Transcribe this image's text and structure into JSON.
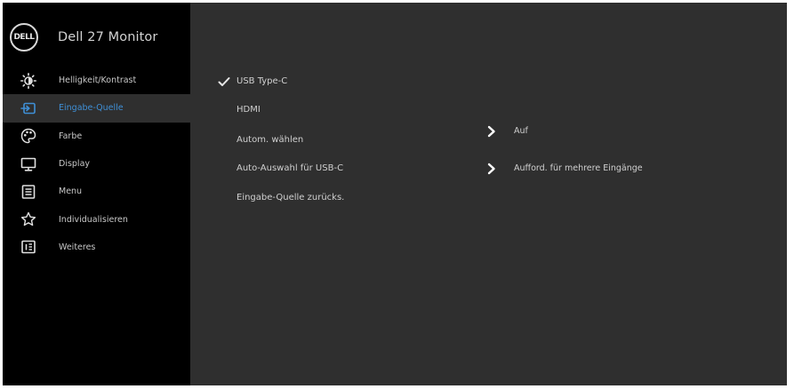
{
  "header": {
    "logo_text": "DELL",
    "title": "Dell 27 Monitor"
  },
  "sidebar": {
    "items": [
      {
        "label": "Helligkeit/Kontrast",
        "icon": "brightness-icon",
        "active": false
      },
      {
        "label": "Eingabe-Quelle",
        "icon": "input-source-icon",
        "active": true
      },
      {
        "label": "Farbe",
        "icon": "color-palette-icon",
        "active": false
      },
      {
        "label": "Display",
        "icon": "display-icon",
        "active": false
      },
      {
        "label": "Menu",
        "icon": "menu-icon",
        "active": false
      },
      {
        "label": "Individualisieren",
        "icon": "star-icon",
        "active": false
      },
      {
        "label": "Weiteres",
        "icon": "info-icon",
        "active": false
      }
    ]
  },
  "main": {
    "options": [
      {
        "label": "USB Type-C",
        "selected": true
      },
      {
        "label": "HDMI",
        "selected": false
      },
      {
        "label": "Autom. wählen",
        "selected": false,
        "value": "Auf"
      },
      {
        "label": "Auto-Auswahl für USB-C",
        "selected": false,
        "value": "Aufford. für mehrere Eingänge"
      },
      {
        "label": "Eingabe-Quelle zurücks.",
        "selected": false
      }
    ]
  },
  "colors": {
    "sidebar_bg": "#000000",
    "main_bg": "#2f2f2f",
    "active_text": "#3f8fd6",
    "text": "#d0d0d0"
  }
}
